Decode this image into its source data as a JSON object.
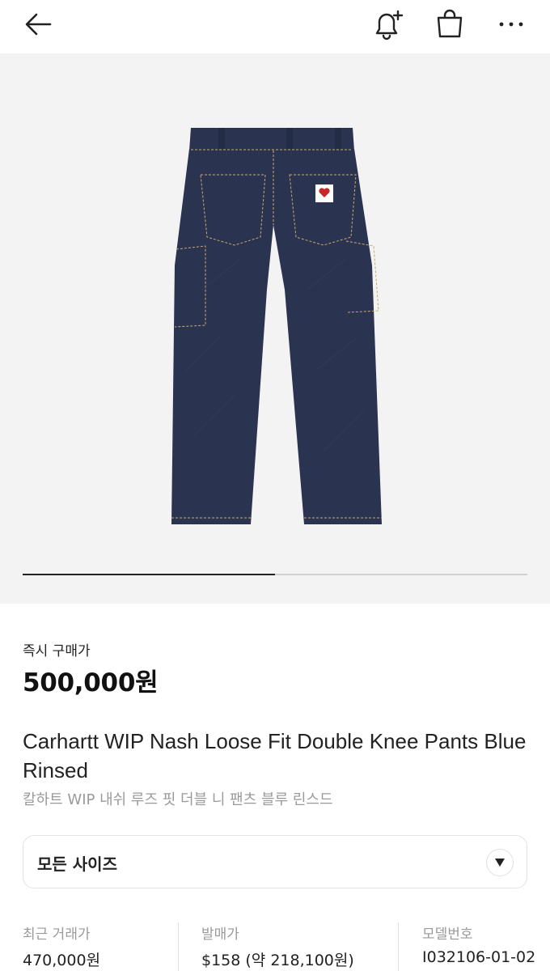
{
  "header": {
    "icons": [
      "back-icon",
      "bell-plus-icon",
      "shopping-bag-icon",
      "more-icon"
    ]
  },
  "gallery": {
    "progress_fraction": 0.5
  },
  "purchase": {
    "buy_label": "즉시 구매가",
    "price": "500,000원"
  },
  "product": {
    "title": "Carhartt WIP Nash Loose Fit Double Knee Pants Blue Rinsed",
    "title_ko": "칼하트 WIP 내쉬 루즈 핏 더블 니 팬츠 블루 린스드"
  },
  "size_selector": {
    "label": "모든 사이즈"
  },
  "info": [
    {
      "label": "최근 거래가",
      "value": "470,000원"
    },
    {
      "label": "발매가",
      "value": "$158 (약 218,100원)"
    },
    {
      "label": "모델번호",
      "value": "I032106-01-02"
    }
  ],
  "colors": {
    "text": "#222222",
    "muted": "#9a9a9a",
    "image_background": "#f3f3f3",
    "denim": "#2a3450",
    "stitch": "#c9a86a"
  }
}
